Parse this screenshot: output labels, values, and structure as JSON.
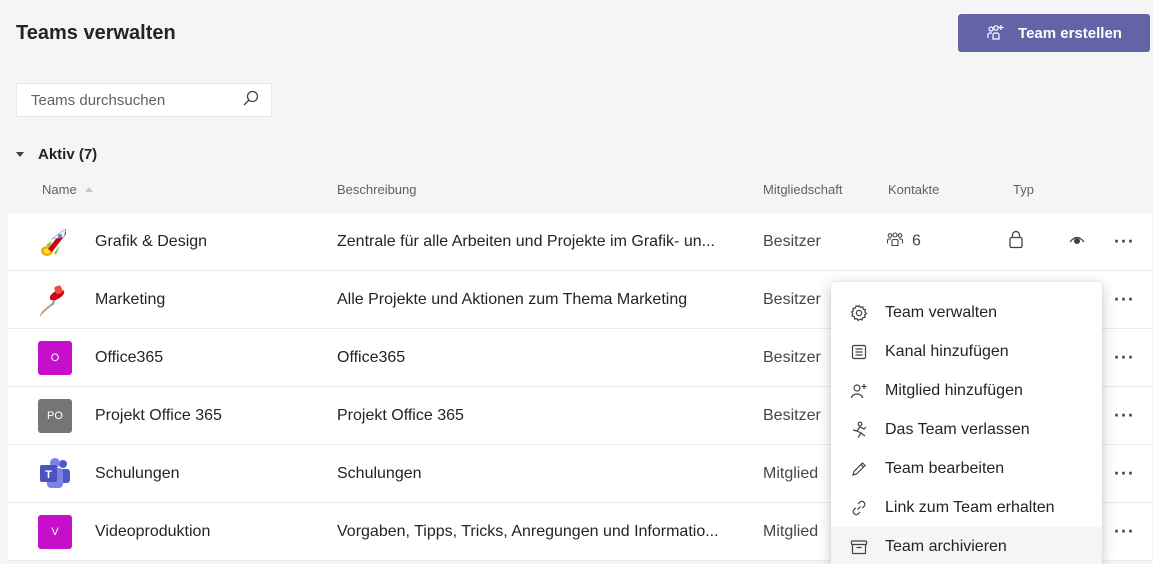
{
  "header": {
    "title": "Teams verwalten",
    "create_button_label": "Team erstellen"
  },
  "search": {
    "placeholder": "Teams durchsuchen"
  },
  "section": {
    "label": "Aktiv (7)"
  },
  "columns": {
    "name": "Name",
    "description": "Beschreibung",
    "membership": "Mitgliedschaft",
    "contacts": "Kontakte",
    "type": "Typ"
  },
  "rows": [
    {
      "name": "Grafik & Design",
      "description": "Zentrale für alle Arbeiten und Projekte im Grafik- un...",
      "membership": "Besitzer",
      "contacts": "6",
      "avatar_icon": "rocket-icon"
    },
    {
      "name": "Marketing",
      "description": "Alle Projekte und Aktionen zum Thema Marketing",
      "membership": "Besitzer",
      "avatar_icon": "pushpin-icon"
    },
    {
      "name": "Office365",
      "description": "Office365",
      "membership": "Besitzer",
      "avatar_text": "O",
      "avatar_color": "#c70fcb"
    },
    {
      "name": "Projekt Office 365",
      "description": "Projekt Office 365",
      "membership": "Besitzer",
      "avatar_text": "PO",
      "avatar_color": "#757575"
    },
    {
      "name": "Schulungen",
      "description": "Schulungen",
      "membership": "Mitglied",
      "avatar_icon": "teams-logo-icon"
    },
    {
      "name": "Videoproduktion",
      "description": "Vorgaben, Tipps, Tricks, Anregungen und Informatio...",
      "membership": "Mitglied",
      "avatar_text": "V",
      "avatar_color": "#c70fcb"
    }
  ],
  "context_menu": {
    "items": [
      {
        "label": "Team verwalten",
        "icon": "gear-icon"
      },
      {
        "label": "Kanal hinzufügen",
        "icon": "channel-icon"
      },
      {
        "label": "Mitglied hinzufügen",
        "icon": "add-member-icon"
      },
      {
        "label": "Das Team verlassen",
        "icon": "leave-icon"
      },
      {
        "label": "Team bearbeiten",
        "icon": "pencil-icon"
      },
      {
        "label": "Link zum Team erhalten",
        "icon": "link-icon"
      },
      {
        "label": "Team archivieren",
        "icon": "archive-icon"
      }
    ]
  },
  "colors": {
    "accent": "#6264a7",
    "background": "#f5f5f5"
  }
}
